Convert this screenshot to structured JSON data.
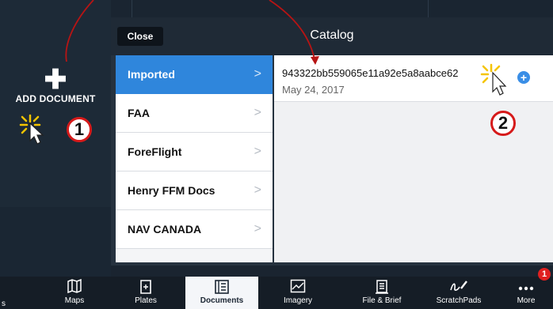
{
  "sidebar": {
    "add_document": {
      "icon": "plus-icon",
      "label": "ADD DOCUMENT"
    }
  },
  "annotations": {
    "step1": "1",
    "step2": "2"
  },
  "catalog": {
    "close_label": "Close",
    "title": "Catalog",
    "categories": [
      {
        "label": "Imported",
        "selected": true
      },
      {
        "label": "FAA",
        "selected": false
      },
      {
        "label": "ForeFlight",
        "selected": false
      },
      {
        "label": "Henry FFM Docs",
        "selected": false
      },
      {
        "label": "NAV CANADA",
        "selected": false
      }
    ],
    "documents": [
      {
        "name": "943322bb559065e11a92e5a8aabce62",
        "date": "May 24, 2017"
      }
    ]
  },
  "tabbar": {
    "left_partial": "s",
    "tabs": [
      {
        "label": "Maps",
        "icon": "map-icon"
      },
      {
        "label": "Plates",
        "icon": "plates-icon"
      },
      {
        "label": "Documents",
        "icon": "documents-icon",
        "active": true
      },
      {
        "label": "Imagery",
        "icon": "imagery-icon"
      },
      {
        "label": "File & Brief",
        "icon": "file-brief-icon"
      },
      {
        "label": "ScratchPads",
        "icon": "scratchpad-icon"
      },
      {
        "label": "More",
        "icon": "more-icon"
      }
    ],
    "more_badge": "1"
  },
  "colors": {
    "accent": "#2f86dc",
    "annotation_red": "#d61a1a",
    "dark_bg": "#1f2b38"
  }
}
